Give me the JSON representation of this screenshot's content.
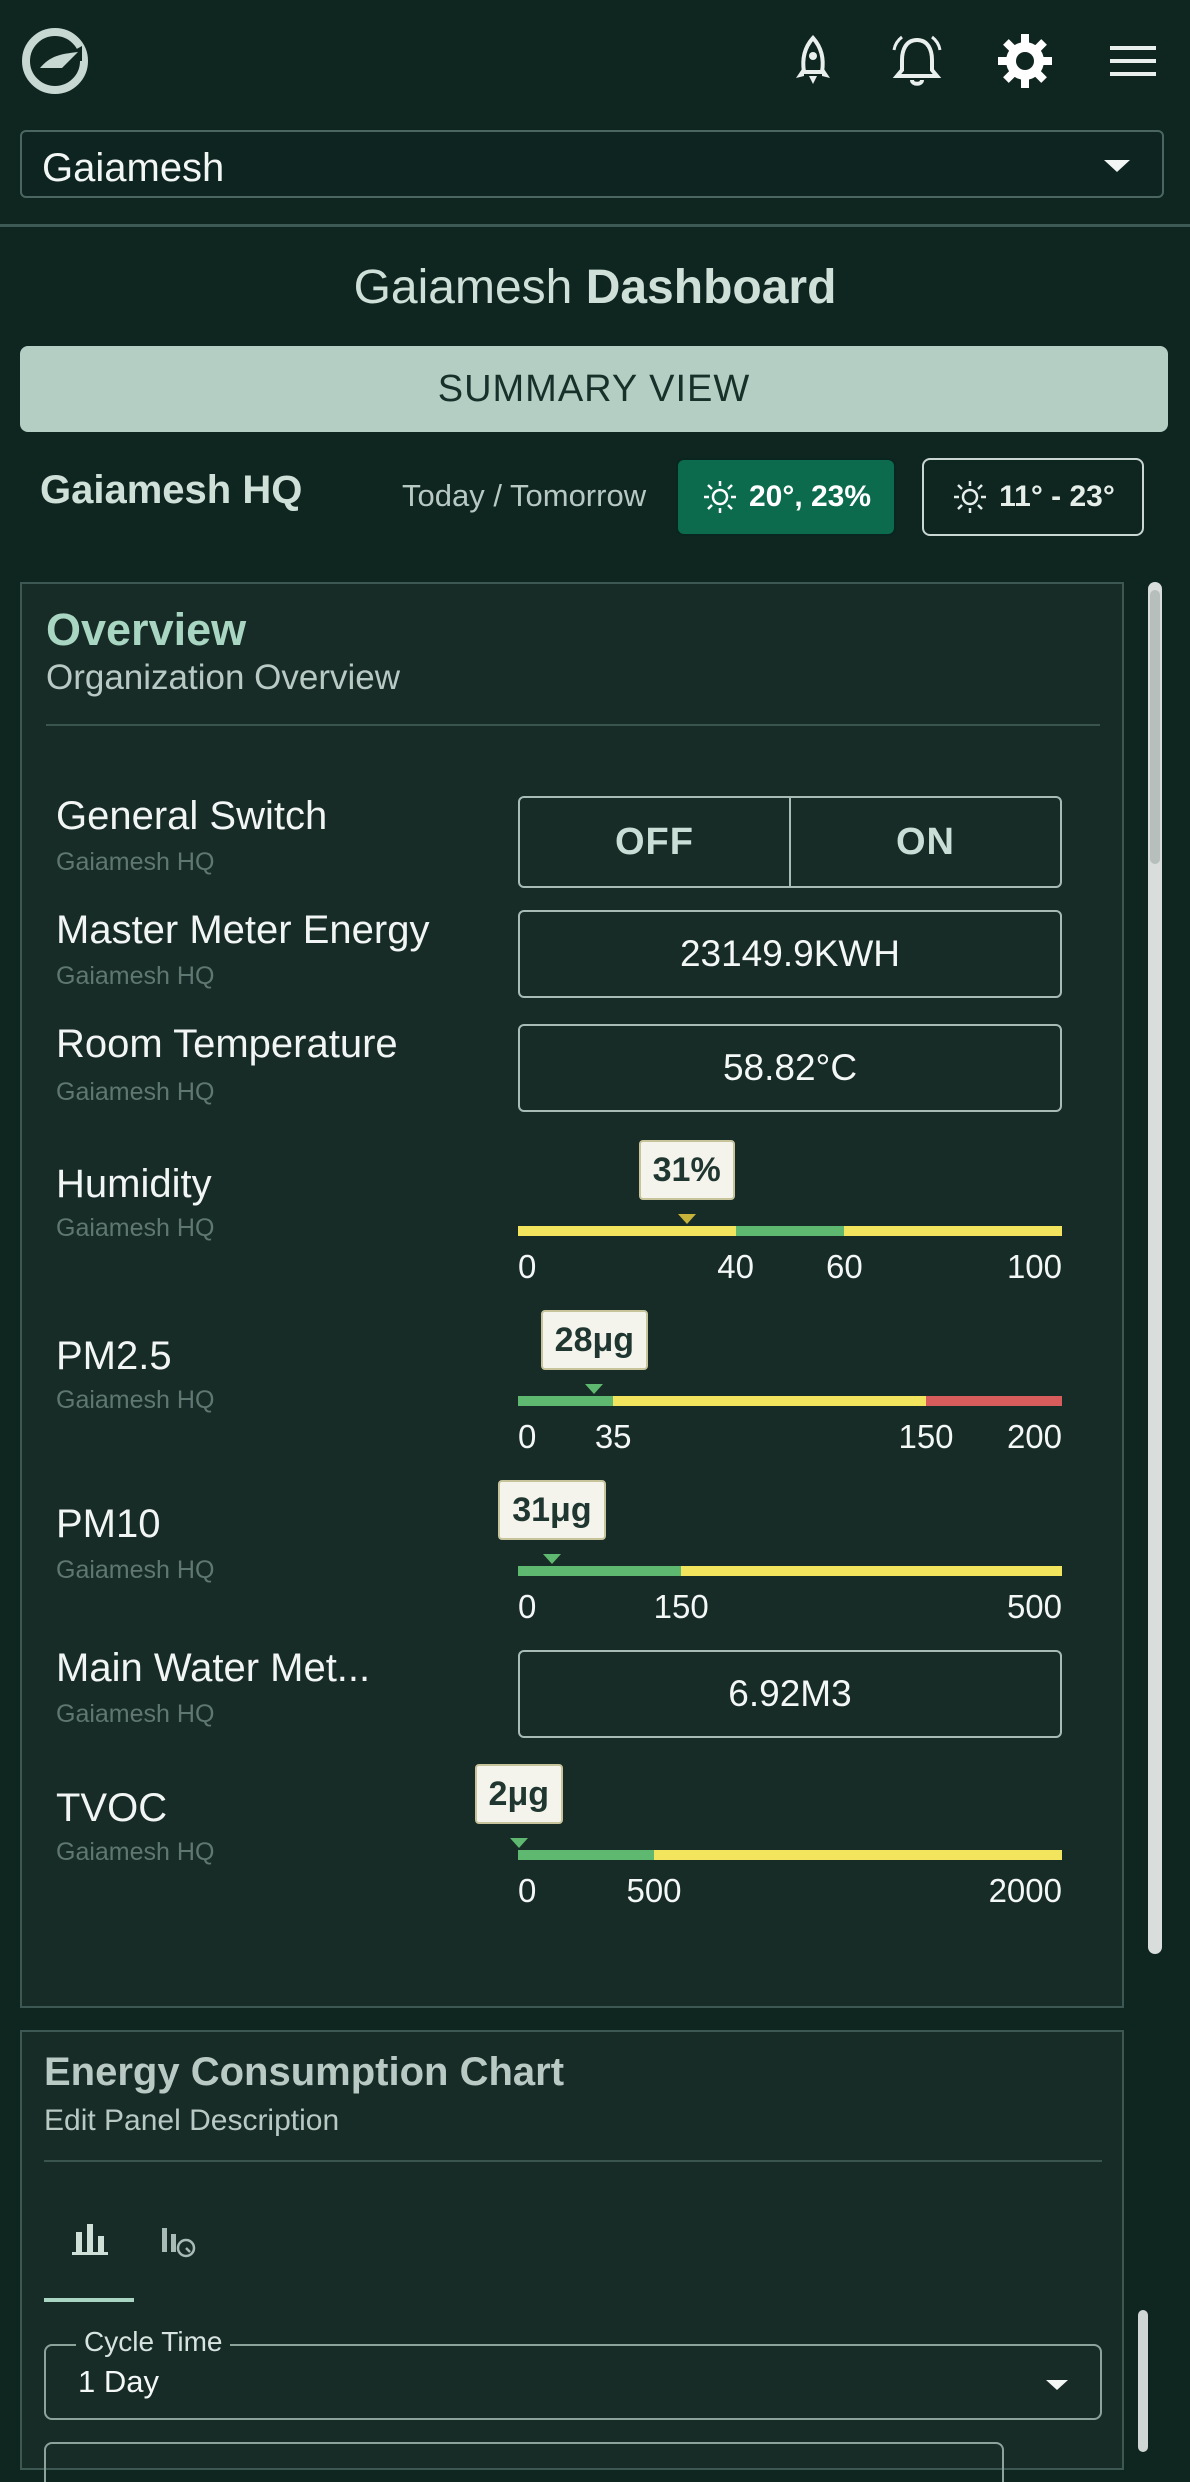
{
  "header": {
    "icons": [
      "app-logo",
      "rocket-icon",
      "bell-icon",
      "gear-icon",
      "menu-icon"
    ],
    "organization_select": {
      "value": "Gaiamesh"
    }
  },
  "dashboard": {
    "title_prefix": "Gaiamesh",
    "title_strong": "Dashboard",
    "summary_button": "SUMMARY VIEW",
    "site_name": "Gaiamesh HQ",
    "weather_label": "Today / Tomorrow",
    "weather_today": "20°, 23%",
    "weather_tomorrow": "11° - 23°"
  },
  "overview": {
    "title": "Overview",
    "subtitle": "Organization Overview",
    "general_switch": {
      "label": "General Switch",
      "location": "Gaiamesh HQ",
      "off_label": "OFF",
      "on_label": "ON"
    },
    "master_meter": {
      "label": "Master Meter Energy",
      "location": "Gaiamesh HQ",
      "value": "23149.9KWH"
    },
    "room_temperature": {
      "label": "Room Temperature",
      "location": "Gaiamesh HQ",
      "value": "58.82°C"
    },
    "humidity": {
      "label": "Humidity",
      "location": "Gaiamesh HQ",
      "reading": "31%",
      "value": 31,
      "min": 0,
      "max": 100,
      "ticks": [
        "0",
        "40",
        "60",
        "100"
      ],
      "tick_values": [
        0,
        40,
        60,
        100
      ],
      "segments": [
        {
          "from": 0,
          "to": 40,
          "color": "#f2e45c"
        },
        {
          "from": 40,
          "to": 60,
          "color": "#5fb86f"
        },
        {
          "from": 60,
          "to": 100,
          "color": "#f2e45c"
        }
      ],
      "pointer_color": "#c7b23a"
    },
    "pm25": {
      "label": "PM2.5",
      "location": "Gaiamesh HQ",
      "reading": "28μg",
      "value": 28,
      "min": 0,
      "max": 200,
      "ticks": [
        "0",
        "35",
        "150",
        "200"
      ],
      "tick_values": [
        0,
        35,
        150,
        200
      ],
      "segments": [
        {
          "from": 0,
          "to": 35,
          "color": "#5fb86f"
        },
        {
          "from": 35,
          "to": 150,
          "color": "#f2e45c"
        },
        {
          "from": 150,
          "to": 200,
          "color": "#d95c5c"
        }
      ],
      "pointer_color": "#5fb86f"
    },
    "pm10": {
      "label": "PM10",
      "location": "Gaiamesh HQ",
      "reading": "31μg",
      "value": 31,
      "min": 0,
      "max": 500,
      "ticks": [
        "0",
        "150",
        "500"
      ],
      "tick_values": [
        0,
        150,
        500
      ],
      "segments": [
        {
          "from": 0,
          "to": 150,
          "color": "#5fb86f"
        },
        {
          "from": 150,
          "to": 500,
          "color": "#f2e45c"
        }
      ],
      "pointer_color": "#5fb86f"
    },
    "water_meter": {
      "label": "Main Water Met...",
      "location": "Gaiamesh HQ",
      "value": "6.92M3"
    },
    "tvoc": {
      "label": "TVOC",
      "location": "Gaiamesh HQ",
      "reading": "2μg",
      "value": 2,
      "min": 0,
      "max": 2000,
      "ticks": [
        "0",
        "500",
        "2000"
      ],
      "tick_values": [
        0,
        500,
        2000
      ],
      "segments": [
        {
          "from": 0,
          "to": 500,
          "color": "#5fb86f"
        },
        {
          "from": 500,
          "to": 2000,
          "color": "#f2e45c"
        }
      ],
      "pointer_color": "#5fb86f"
    }
  },
  "energy_panel": {
    "title": "Energy Consumption Chart",
    "subtitle": "Edit Panel Description",
    "tabs": [
      "bar-chart-icon",
      "bar-chart-clock-icon"
    ],
    "cycle_label": "Cycle Time",
    "cycle_value": "1 Day"
  }
}
